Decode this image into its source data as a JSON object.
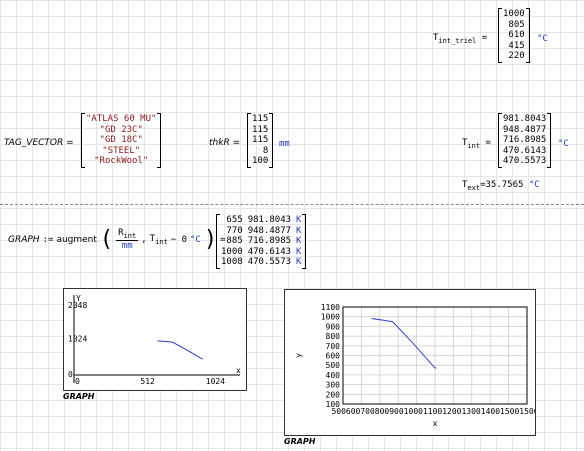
{
  "t_int_triel": {
    "label": "T",
    "sub": "int_triel",
    "eq": "=",
    "values": [
      "1000",
      "805",
      "610",
      "415",
      "220"
    ],
    "unit": "°C"
  },
  "tag_vector": {
    "label": "TAG_VECTOR",
    "eq": "=",
    "values": [
      "\"ATLAS 60 MU\"",
      "\"GD 23C\"",
      "\"GD 18C\"",
      "\"STEEL\"",
      "\"RockWool\""
    ]
  },
  "thkr": {
    "label": "thkR",
    "eq": "=",
    "values": [
      "115",
      "115",
      "115",
      "8",
      "100"
    ],
    "unit": "mm"
  },
  "t_int": {
    "label": "T",
    "sub": "int",
    "eq": "=",
    "values": [
      "981.8043",
      "948.4877",
      "716.8985",
      "470.6143",
      "470.5573"
    ],
    "unit": "°C"
  },
  "t_ext": {
    "label": "T",
    "sub": "ext",
    "eq": "=",
    "value": "35.7565",
    "unit": "°C"
  },
  "graph_def": {
    "lhs": "GRAPH",
    "assign": ":=",
    "func": "augment",
    "num": "R",
    "num_sub": "int",
    "den": "mm",
    "comma": ",",
    "t": "T",
    "t_sub": "int",
    "minus": "− 0",
    "unit": "°C",
    "eq": "=",
    "col1": [
      "655",
      "770",
      "885",
      "1000",
      "1008"
    ],
    "col2": [
      "981.8043",
      "948.4877",
      "716.8985",
      "470.6143",
      "470.5573"
    ],
    "col3": [
      "K",
      "K",
      "K",
      "K",
      "K"
    ]
  },
  "plot1": {
    "caption": "GRAPH",
    "y_label": "Y",
    "x_label": "x",
    "y_ticks": [
      "2048",
      "1024",
      "0"
    ],
    "x_ticks": [
      "0",
      "512",
      "1024"
    ]
  },
  "plot2": {
    "caption": "GRAPH",
    "y_label": "y",
    "x_label": "x",
    "y_ticks": [
      "1100",
      "1000",
      "900",
      "800",
      "700",
      "600",
      "500",
      "400",
      "300",
      "200",
      "100"
    ],
    "x_ticks_text": "5006007008009001000110012001300140015001500"
  },
  "chart_data": [
    {
      "type": "line",
      "x": [
        655,
        770,
        885,
        1000,
        1008
      ],
      "y": [
        981.8043,
        948.4877,
        716.8985,
        470.6143,
        470.5573
      ],
      "xlabel": "x",
      "ylabel": "Y",
      "xlim": [
        0,
        1300
      ],
      "ylim": [
        0,
        2300
      ],
      "grid": false,
      "color": "#2a3fcf"
    },
    {
      "type": "line",
      "x": [
        655,
        770,
        885,
        1000,
        1008
      ],
      "y": [
        981.8043,
        948.4877,
        716.8985,
        470.6143,
        470.5573
      ],
      "xlabel": "x",
      "ylabel": "y",
      "xlim": [
        500,
        1500
      ],
      "ylim": [
        100,
        1100
      ],
      "grid": true,
      "color": "#2a3fcf"
    }
  ]
}
